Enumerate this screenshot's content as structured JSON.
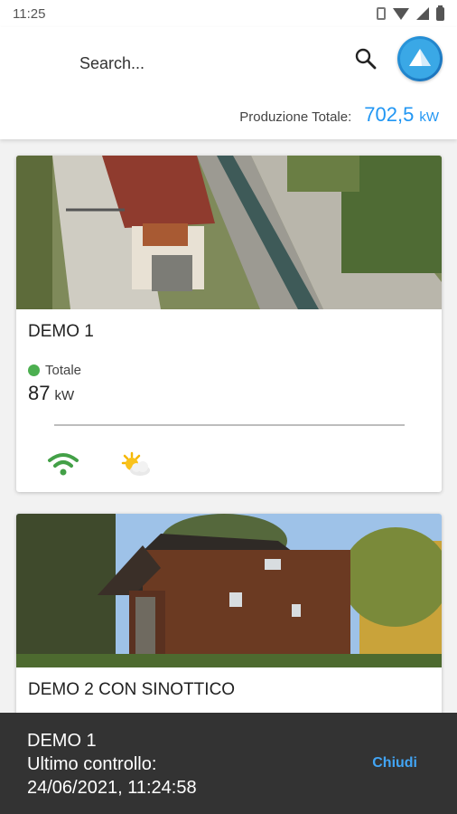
{
  "status_bar": {
    "time": "11:25"
  },
  "header": {
    "search_placeholder": "Search...",
    "total_label": "Produzione Totale:",
    "total_value": "702,5",
    "total_unit": "kW"
  },
  "plants": [
    {
      "name": "DEMO 1",
      "status_label": "Totale",
      "status_color": "#4caf50",
      "power_value": "87",
      "power_unit": "kW",
      "icons": [
        "wifi-icon",
        "partly-cloudy-icon"
      ]
    },
    {
      "name": "DEMO 2 CON SINOTTICO"
    }
  ],
  "snackbar": {
    "title": "DEMO 1",
    "line2": "Ultimo controllo:",
    "line3": "24/06/2021, 11:24:58",
    "action": "Chiudi"
  },
  "colors": {
    "accent": "#2196f3",
    "online": "#4caf50",
    "snackbar_bg": "#333333"
  }
}
